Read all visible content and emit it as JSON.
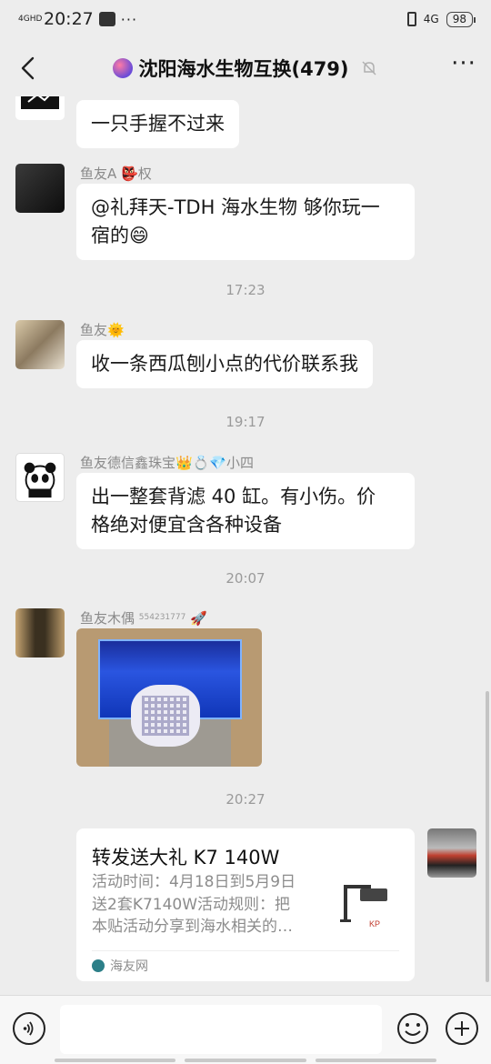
{
  "status_bar": {
    "network_label": "4GHD",
    "time": "20:27",
    "right_network": "4G",
    "battery": "98"
  },
  "header": {
    "title": "沈阳海水生物互换(479)",
    "more_label": "···"
  },
  "messages": [
    {
      "bubble": "一只手握不过来"
    },
    {
      "nick": "鱼友A 👺权",
      "bubble_line1": "@礼拜天-TDH 海水生物  够你玩一",
      "bubble_line2": "宿的😄"
    },
    {
      "time": "17:23"
    },
    {
      "nick": "鱼友🌞",
      "bubble": "收一条西瓜刨小点的代价联系我"
    },
    {
      "time": "19:17"
    },
    {
      "nick": "鱼友德信鑫珠宝👑💍💎小四",
      "bubble_line1": "出一整套背滤 40 缸。有小伤。价",
      "bubble_line2": "格绝对便宜含各种设备"
    },
    {
      "time": "20:07"
    },
    {
      "nick": "鱼友木偶",
      "nick_suffix": "554231777",
      "nick_icon": "rocket-icon"
    },
    {
      "time": "20:27"
    }
  ],
  "share_card": {
    "title": "转发送大礼 K7 140W",
    "desc_line1": "活动时间：4月18日到5月9日",
    "desc_line2": "送2套K7140W活动规则：把",
    "desc_line3": "本贴活动分享到海水相关的…",
    "source": "海友网"
  },
  "colors": {
    "background": "#ededed",
    "bubble": "#ffffff",
    "meta_text": "#8a8a8a"
  }
}
